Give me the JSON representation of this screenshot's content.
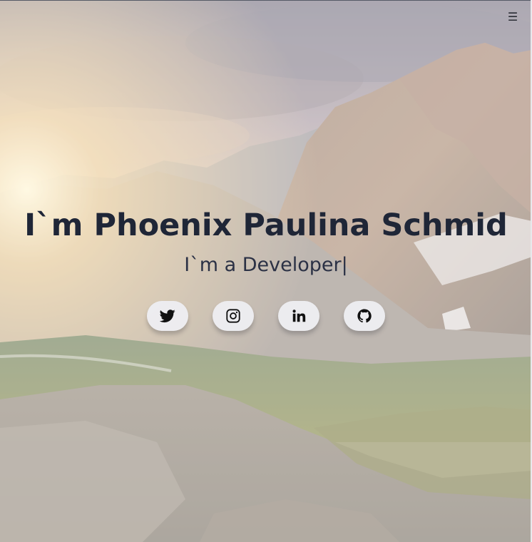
{
  "header": {
    "menu_icon": "hamburger-icon",
    "menu_glyph": "☰"
  },
  "hero": {
    "name": "I`m Phoenix Paulina Schmid",
    "tagline": "I`m a Developer|"
  },
  "socials": [
    {
      "icon": "twitter-icon"
    },
    {
      "icon": "instagram-icon"
    },
    {
      "icon": "linkedin-icon"
    },
    {
      "icon": "github-icon"
    }
  ],
  "colors": {
    "title_text": "#1f2637",
    "social_button_bg": "#eeeef2"
  }
}
